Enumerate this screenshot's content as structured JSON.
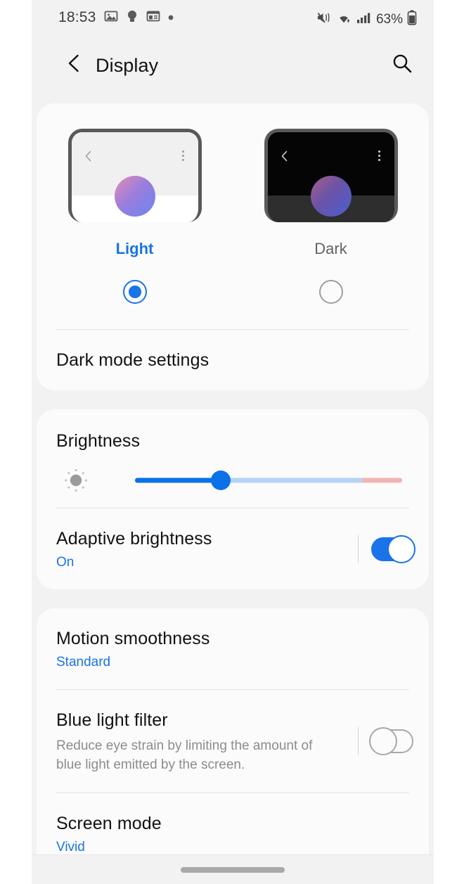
{
  "status_bar": {
    "time": "18:53",
    "left_icons": [
      "image-icon",
      "lightbulb-icon",
      "calendar-widget-icon",
      "dot-icon"
    ],
    "right_icons": [
      "mute-vibrate-icon",
      "wifi-icon",
      "signal-bars-icon",
      "battery-icon"
    ],
    "battery_text": "63%"
  },
  "header": {
    "back_icon": "chevron-left-icon",
    "title": "Display",
    "search_icon": "search-icon"
  },
  "theme": {
    "light": {
      "label": "Light",
      "selected": true,
      "preview_back_icon": "chevron-left-icon",
      "preview_menu_icon": "more-vertical-icon"
    },
    "dark": {
      "label": "Dark",
      "selected": false,
      "preview_back_icon": "chevron-left-icon",
      "preview_menu_icon": "more-vertical-icon"
    },
    "dark_mode_settings": "Dark mode settings"
  },
  "brightness": {
    "title": "Brightness",
    "icon": "brightness-sun-icon",
    "value_percent": 32,
    "extra_zone_start_percent": 85,
    "adaptive": {
      "title": "Adaptive brightness",
      "subtitle": "On",
      "toggle_state": "on"
    }
  },
  "display_options": {
    "motion_smoothness": {
      "title": "Motion smoothness",
      "subtitle": "Standard"
    },
    "blue_light_filter": {
      "title": "Blue light filter",
      "description": "Reduce eye strain by limiting the amount of blue light emitted by the screen.",
      "toggle_state": "off"
    },
    "screen_mode": {
      "title": "Screen mode",
      "subtitle": "Vivid"
    }
  },
  "nav_bar": {
    "handle": "gesture-handle"
  },
  "colors": {
    "accent_blue": "#1a73e8",
    "slider_blue": "#0a71e8",
    "slider_track": "#b3d4f7",
    "slider_hot": "#f3b3b3",
    "background": "#f2f2f2",
    "card": "#fbfbfb",
    "text_primary": "#121212",
    "text_secondary": "#8c8c8c"
  }
}
